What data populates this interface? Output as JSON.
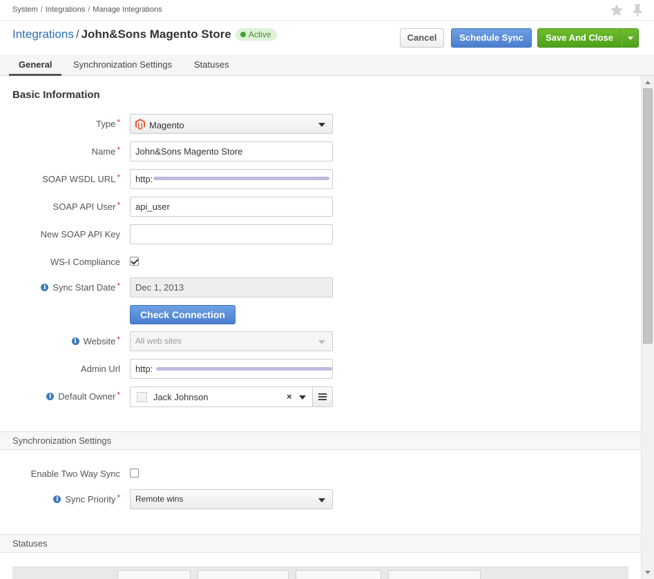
{
  "breadcrumb": {
    "items": [
      "System",
      "Integrations",
      "Manage Integrations"
    ],
    "separator": "/"
  },
  "header": {
    "title_link": "Integrations",
    "title_separator": "/",
    "title_name": "John&Sons Magento Store",
    "status": "Active",
    "buttons": {
      "cancel": "Cancel",
      "schedule_sync": "Schedule Sync",
      "save_and_close": "Save And Close"
    }
  },
  "tabs": [
    "General",
    "Synchronization Settings",
    "Statuses"
  ],
  "basic_information": {
    "title": "Basic Information",
    "fields": {
      "type": {
        "label": "Type",
        "value": "Magento"
      },
      "name": {
        "label": "Name",
        "value": "John&Sons Magento Store"
      },
      "soap_wsdl_url": {
        "label": "SOAP WSDL URL",
        "value": "http:"
      },
      "soap_api_user": {
        "label": "SOAP API User",
        "value": "api_user"
      },
      "new_soap_api_key": {
        "label": "New SOAP API Key",
        "value": ""
      },
      "ws_i_compliance": {
        "label": "WS-I Compliance",
        "checked": true
      },
      "sync_start_date": {
        "label": "Sync Start Date",
        "value": "Dec 1, 2013"
      },
      "check_connection": "Check Connection",
      "website": {
        "label": "Website",
        "value": "All web sites"
      },
      "admin_url": {
        "label": "Admin Url",
        "value": "http:"
      },
      "default_owner": {
        "label": "Default Owner",
        "value": "Jack Johnson"
      }
    }
  },
  "sync_settings": {
    "title": "Synchronization Settings",
    "enable_two_way_sync": {
      "label": "Enable Two Way Sync",
      "checked": false
    },
    "sync_priority": {
      "label": "Sync Priority",
      "value": "Remote wins"
    }
  },
  "statuses": {
    "title": "Statuses"
  },
  "colors": {
    "link": "#2a6db7",
    "primary_button": "#4a7fd0",
    "save_button": "#4ea019",
    "active_badge": "#dff2d8",
    "required": "#d0342c"
  }
}
